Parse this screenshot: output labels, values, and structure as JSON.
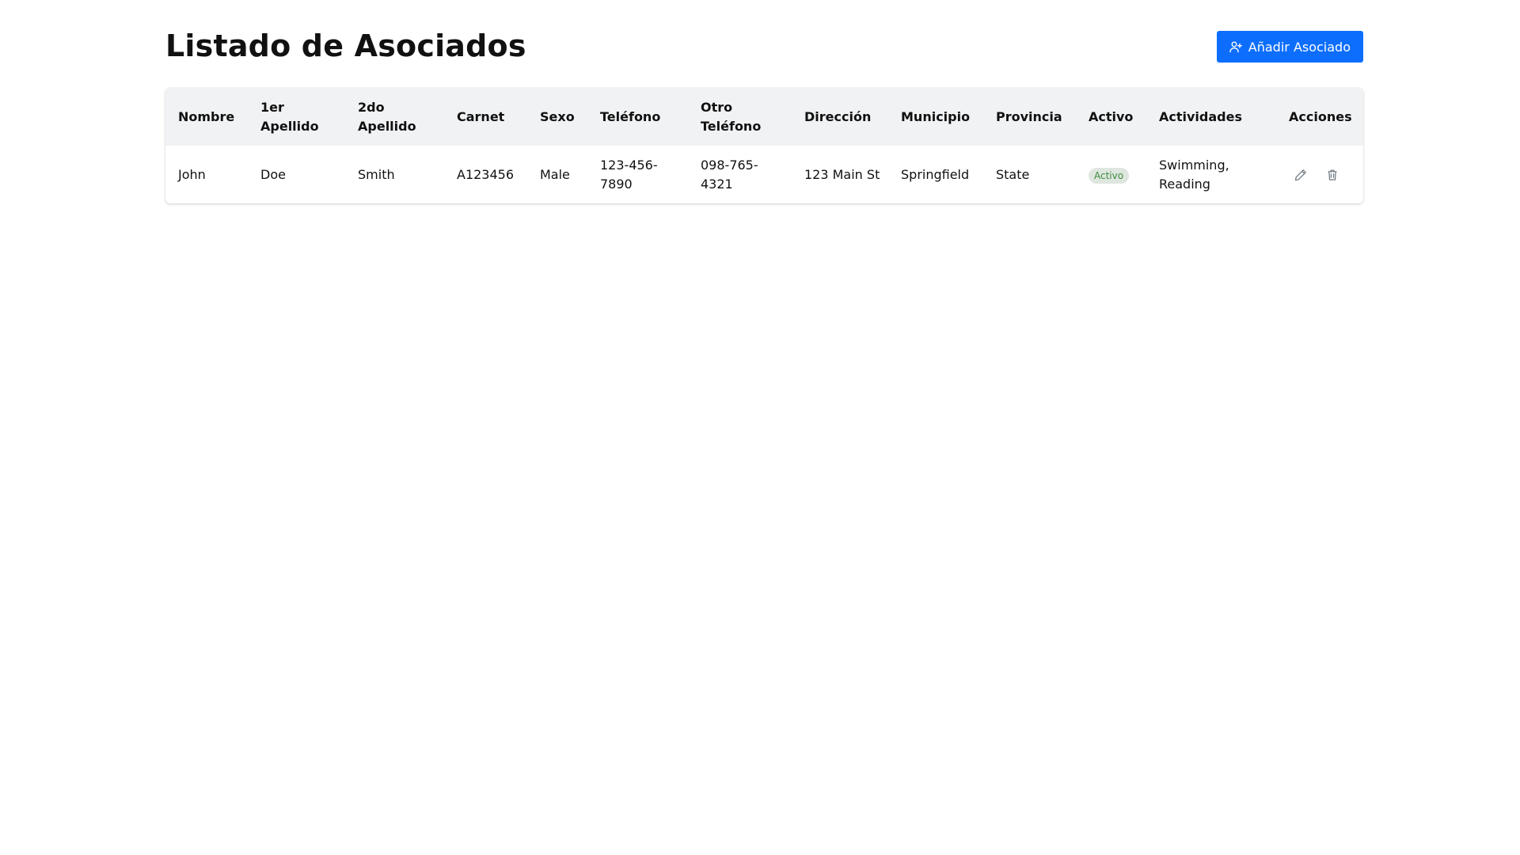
{
  "header": {
    "title": "Listado de Asociados",
    "add_button_label": "Añadir Asociado",
    "add_button_icon": "user-plus-icon"
  },
  "colors": {
    "primary": "#0d6efd",
    "header_row_bg": "#f1f2f4",
    "badge_bg": "#dfe6df",
    "badge_text": "#3c8c3c",
    "icon_gray": "#6c757d"
  },
  "table": {
    "columns": [
      "Nombre",
      "1er Apellido",
      "2do Apellido",
      "Carnet",
      "Sexo",
      "Teléfono",
      "Otro Teléfono",
      "Dirección",
      "Municipio",
      "Provincia",
      "Activo",
      "Actividades",
      "Acciones"
    ],
    "rows": [
      {
        "nombre": "John",
        "apellido1": "Doe",
        "apellido2": "Smith",
        "carnet": "A123456",
        "sexo": "Male",
        "telefono": "123-456-7890",
        "otro_telefono": "098-765-4321",
        "direccion": "123 Main St",
        "municipio": "Springfield",
        "provincia": "State",
        "activo": "Activo",
        "actividades": "Swimming, Reading",
        "actions": {
          "edit_icon": "pencil-icon",
          "delete_icon": "trash-icon"
        }
      }
    ]
  }
}
